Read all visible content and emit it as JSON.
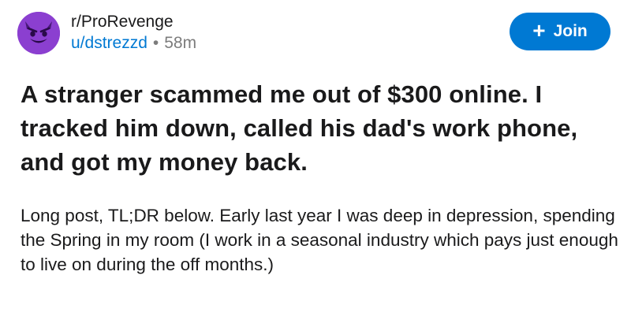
{
  "post": {
    "subreddit": "r/ProRevenge",
    "username": "u/dstrezzd",
    "separator": "•",
    "age": "58m",
    "join_label": "Join",
    "join_icon": "+",
    "title": "A stranger scammed me out of $300 online. I tracked him down, called his dad's work phone, and got my money back.",
    "body": "Long post, TL;DR below. Early last year I was deep in depression, spending the Spring in my room (I work in a seasonal industry which pays just enough to live on during the off months.)"
  },
  "colors": {
    "accent": "#0079d3",
    "avatar_bg": "#8b3fd0",
    "text": "#1a1a1b",
    "muted": "#7c7c7c"
  },
  "icons": {
    "avatar": "devil-face-icon",
    "join": "plus-icon"
  }
}
